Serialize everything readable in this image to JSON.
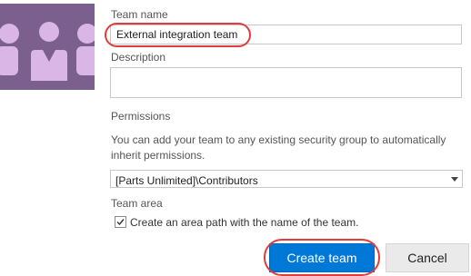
{
  "team_image": {
    "background": "#7a5f8f",
    "figure_color": "#d9b6e6",
    "icon": "team-members-icon"
  },
  "form": {
    "team_name": {
      "label": "Team name",
      "value": "External integration team"
    },
    "description": {
      "label": "Description",
      "value": ""
    },
    "permissions": {
      "label": "Permissions",
      "help_text": "You can add your team to any existing security group to automatically inherit permissions.",
      "selected": "[Parts Unlimited]\\Contributors"
    },
    "team_area": {
      "label": "Team area",
      "checkbox_label": "Create an area path with the name of the team.",
      "checked": true
    }
  },
  "buttons": {
    "create_label": "Create team",
    "cancel_label": "Cancel"
  },
  "colors": {
    "primary": "#0078d7",
    "highlight": "#e03c3c"
  }
}
